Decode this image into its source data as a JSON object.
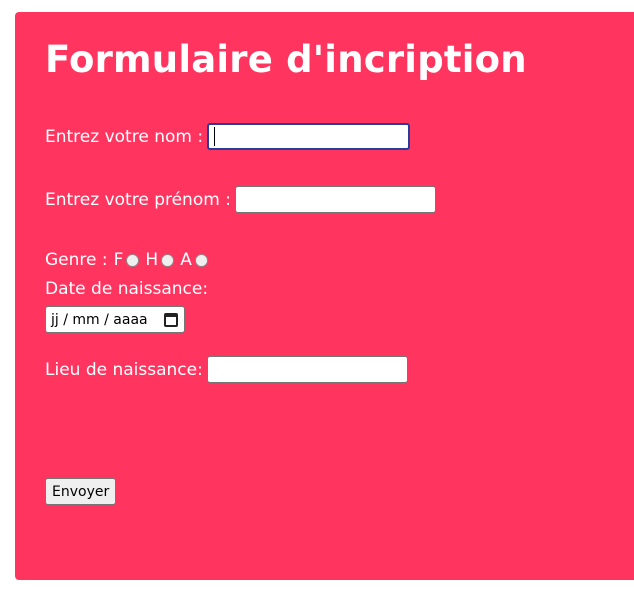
{
  "form": {
    "title": "Formulaire d'incription",
    "nom_label": "Entrez votre nom :",
    "nom_value": "",
    "prenom_label": "Entrez votre prénom :",
    "prenom_value": "",
    "genre_label": "Genre :",
    "genre_options": [
      "F",
      "H",
      "A"
    ],
    "date_label": "Date de naissance:",
    "date_placeholder": "jj / mm / aaaa",
    "lieu_label": "Lieu de naissance:",
    "lieu_value": "",
    "submit_label": "Envoyer"
  },
  "icons": {
    "date": "calendar-icon"
  },
  "colors": {
    "background": "#ff3560",
    "text": "#ffffff",
    "focus_border": "#2a3b9c"
  }
}
